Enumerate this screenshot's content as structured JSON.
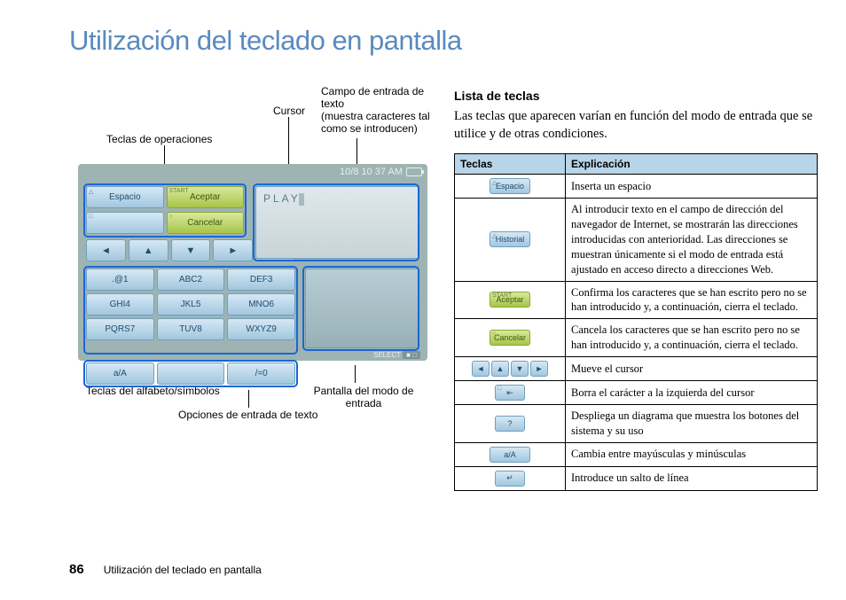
{
  "title": "Utilización del teclado en pantalla",
  "callouts": {
    "ops": "Teclas de operaciones",
    "cursor": "Cursor",
    "field": "Campo de entrada de texto",
    "field_note": "(muestra caracteres tal como se introducen)",
    "alpha": "Teclas del alfabeto/símbolos",
    "mode": "Pantalla del modo de entrada",
    "textopts": "Opciones de entrada de texto"
  },
  "diagram": {
    "time": "10/8 10 37 AM",
    "ops": {
      "espacio": "Espacio",
      "aceptar": "Aceptar",
      "cancelar": "Cancelar"
    },
    "nav": [
      "◄",
      "▲",
      "▼",
      "►",
      "⇤"
    ],
    "alpha": [
      ".@1",
      "ABC2",
      "DEF3",
      "GHI4",
      "JKL5",
      "MNO6",
      "PQRS7",
      "TUV8",
      "WXYZ9"
    ],
    "textopts": [
      "a/A",
      "",
      "/=0"
    ],
    "play": "PLAY",
    "select": "SELECT"
  },
  "right": {
    "h2": "Lista de teclas",
    "intro": "Las teclas que aparecen varían en función del modo de entrada que se utilice y de otras condiciones.",
    "th1": "Teclas",
    "th2": "Explicación",
    "rows": {
      "espacio": "Inserta un espacio",
      "historial": "Al introducir texto en el campo de dirección del navegador de Internet, se mostrarán las direcciones introducidas con anterioridad. Las direcciones se muestran únicamente si el modo de entrada está ajustado en acceso directo a direcciones Web.",
      "aceptar": "Confirma los caracteres que se han escrito pero no se han introducido y, a continuación, cierra el teclado.",
      "cancelar": "Cancela los caracteres que se han escrito pero no se han introducido y, a continuación, cierra el teclado.",
      "cursor": "Mueve el cursor",
      "borrar": "Borra el carácter a la izquierda del cursor",
      "ayuda": "Despliega un diagrama que muestra los botones del sistema y su uso",
      "mayus": "Cambia entre mayúsculas y minúsculas",
      "enter": "Introduce un salto de línea"
    },
    "keylabels": {
      "espacio": "Espacio",
      "historial": "Historial",
      "aceptar": "Aceptar",
      "cancelar": "Cancelar",
      "aA": "a/A"
    }
  },
  "footer": {
    "page": "86",
    "text": "Utilización del teclado en pantalla"
  }
}
